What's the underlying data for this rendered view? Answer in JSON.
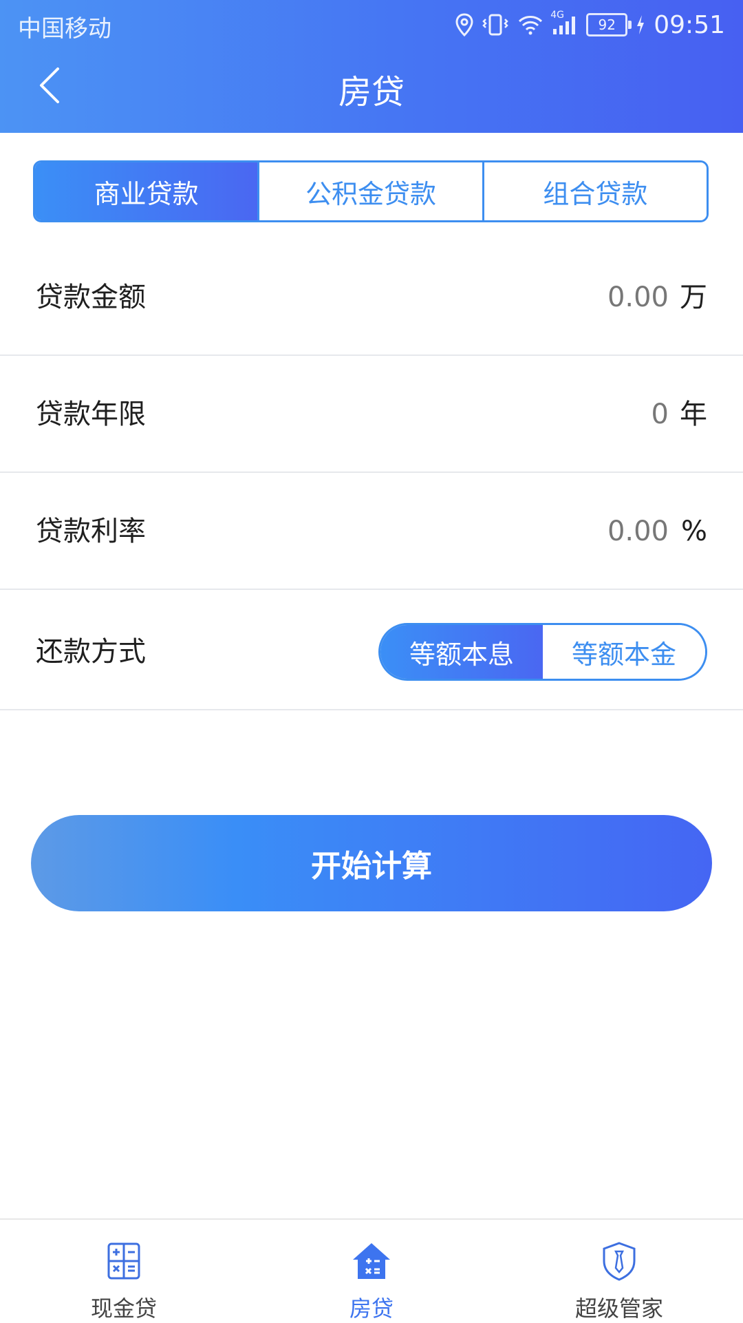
{
  "status_bar": {
    "carrier": "中国移动",
    "network": "4G",
    "battery": "92",
    "time": "09:51"
  },
  "header": {
    "title": "房贷",
    "back_icon": "chevron-left-icon"
  },
  "loan_tabs": [
    {
      "label": "商业贷款",
      "active": true
    },
    {
      "label": "公积金贷款",
      "active": false
    },
    {
      "label": "组合贷款",
      "active": false
    }
  ],
  "form": {
    "amount": {
      "label": "贷款金额",
      "value": "0.00",
      "unit": "万"
    },
    "term": {
      "label": "贷款年限",
      "value": "0",
      "unit": "年"
    },
    "rate": {
      "label": "贷款利率",
      "value": "0.00",
      "unit": "%"
    },
    "repayment": {
      "label": "还款方式",
      "options": [
        {
          "label": "等额本息",
          "active": true
        },
        {
          "label": "等额本金",
          "active": false
        }
      ]
    }
  },
  "calculate_button": "开始计算",
  "bottom_nav": [
    {
      "label": "现金贷",
      "icon": "calculator-icon",
      "active": false
    },
    {
      "label": "房贷",
      "icon": "house-calculator-icon",
      "active": true
    },
    {
      "label": "超级管家",
      "icon": "shield-tie-icon",
      "active": false
    }
  ],
  "colors": {
    "accent": "#3d8ef0",
    "header_start": "#4c93f4",
    "header_end": "#4760f2",
    "nav_active": "#3d74ef"
  }
}
